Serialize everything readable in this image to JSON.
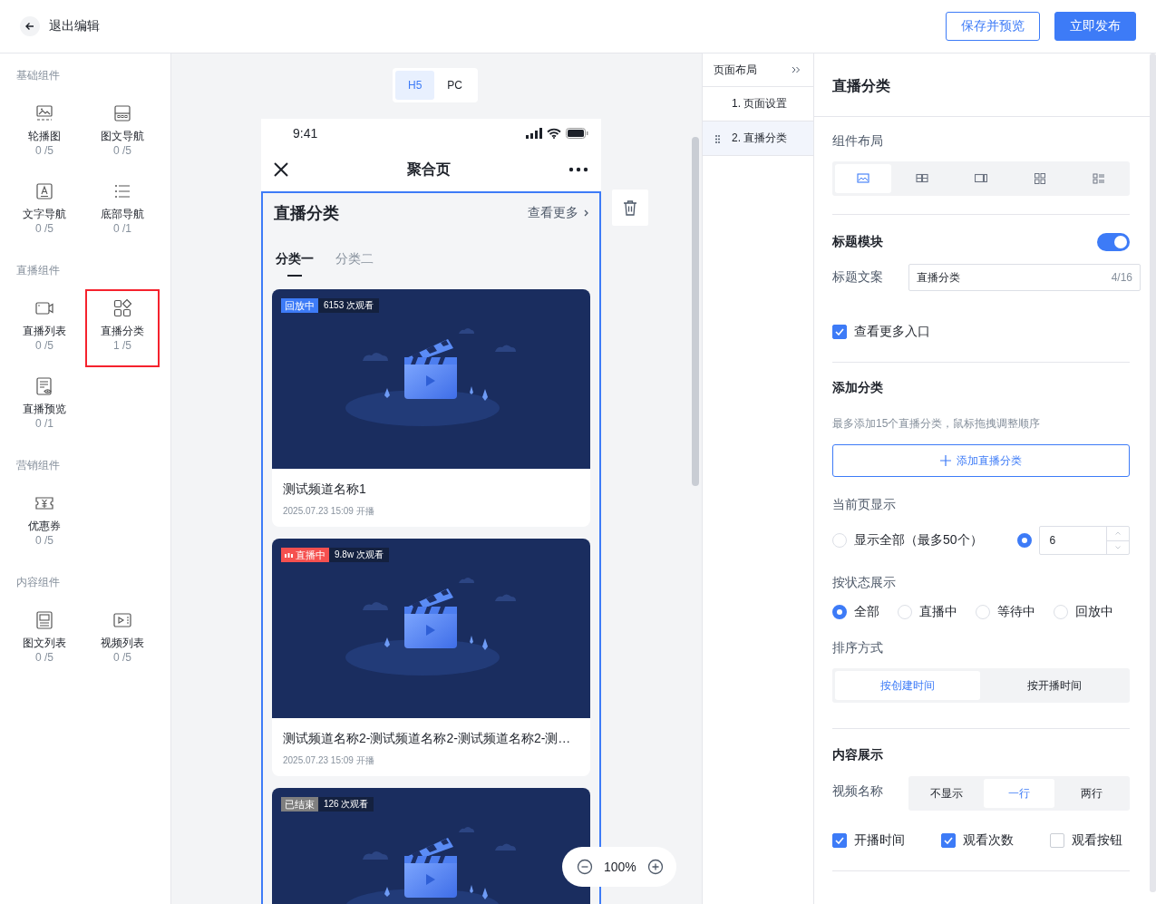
{
  "top_bar": {
    "back_label": "退出编辑",
    "buttons": [
      {
        "label": "保存并预览",
        "kind": "outline"
      },
      {
        "label": "立即发布",
        "kind": "primary"
      }
    ]
  },
  "palette": {
    "groups": [
      {
        "title": "基础组件",
        "items": [
          {
            "label": "轮播图",
            "count": "0 /5",
            "kind": "carousel",
            "selected": false
          },
          {
            "label": "图文导航",
            "count": "0 /5",
            "kind": "graphic-nav",
            "selected": false
          },
          {
            "label": "文字导航",
            "count": "0 /5",
            "kind": "text-nav",
            "selected": false
          },
          {
            "label": "底部导航",
            "count": "0 /1",
            "kind": "bottom-nav",
            "selected": false
          }
        ]
      },
      {
        "title": "直播组件",
        "items": [
          {
            "label": "直播列表",
            "count": "0 /5",
            "kind": "live-list",
            "selected": false
          },
          {
            "label": "直播分类",
            "count": "1 /5",
            "kind": "live-category",
            "selected": true
          },
          {
            "label": "直播预览",
            "count": "0 /1",
            "kind": "live-preview",
            "selected": false
          }
        ]
      },
      {
        "title": "营销组件",
        "items": [
          {
            "label": "优惠券",
            "count": "0 /5",
            "kind": "coupon",
            "selected": false
          }
        ]
      },
      {
        "title": "内容组件",
        "items": [
          {
            "label": "图文列表",
            "count": "0 /5",
            "kind": "graphic-list",
            "selected": false
          },
          {
            "label": "视频列表",
            "count": "0 /5",
            "kind": "video-list",
            "selected": false
          }
        ]
      }
    ]
  },
  "preview": {
    "device_tabs": [
      {
        "label": "H5",
        "selected": true
      },
      {
        "label": "PC",
        "selected": false
      }
    ],
    "status_time": "9:41",
    "page_title": "聚合页",
    "section": {
      "title": "直播分类",
      "more": "查看更多",
      "tabs": [
        {
          "label": "分类一",
          "selected": true
        },
        {
          "label": "分类二",
          "selected": false
        }
      ]
    },
    "cards": [
      {
        "status": "回放中",
        "kind": "replay",
        "views": "6153 次观看",
        "title": "测试频道名称1",
        "time": "2025.07.23 15:09 开播"
      },
      {
        "status": "直播中",
        "kind": "live",
        "views": "9.8w 次观看",
        "title": "测试频道名称2-测试频道名称2-测试频道名称2-测…",
        "time": "2025.07.23 15:09 开播"
      },
      {
        "status": "已结束",
        "kind": "ended",
        "views": "126 次观看"
      }
    ],
    "zoom": "100%"
  },
  "layers": {
    "title": "页面布局",
    "items": [
      {
        "label": "1. 页面设置",
        "selected": false
      },
      {
        "label": "2. 直播分类",
        "selected": true
      }
    ]
  },
  "settings": {
    "title": "直播分类",
    "layout_label": "组件布局",
    "layout_options": [
      {
        "kind": "single",
        "selected": true
      },
      {
        "kind": "double",
        "selected": false
      },
      {
        "kind": "side",
        "selected": false
      },
      {
        "kind": "grid",
        "selected": false
      },
      {
        "kind": "list",
        "selected": false
      }
    ],
    "title_module": {
      "label": "标题模块",
      "on": true
    },
    "title_text": {
      "label": "标题文案",
      "value": "直播分类",
      "counter": "4/16"
    },
    "more_entry": {
      "label": "查看更多入口",
      "checked": true
    },
    "add_category": {
      "heading": "添加分类",
      "hint": "最多添加15个直播分类，鼠标拖拽调整顺序",
      "button": "添加直播分类"
    },
    "per_page": {
      "label": "当前页显示",
      "options": [
        {
          "kind": "text",
          "label": "显示全部（最多50个）",
          "selected": false
        },
        {
          "kind": "number",
          "value": "6",
          "selected": true
        }
      ]
    },
    "status_filter": {
      "label": "按状态展示",
      "options": [
        {
          "label": "全部",
          "selected": true
        },
        {
          "label": "直播中",
          "selected": false
        },
        {
          "label": "等待中",
          "selected": false
        },
        {
          "label": "回放中",
          "selected": false
        }
      ]
    },
    "sort": {
      "label": "排序方式",
      "options": [
        {
          "label": "按创建时间",
          "selected": true
        },
        {
          "label": "按开播时间",
          "selected": false
        }
      ]
    },
    "content_heading": "内容展示",
    "video_name": {
      "label": "视频名称",
      "options": [
        {
          "label": "不显示",
          "selected": false
        },
        {
          "label": "一行",
          "selected": true
        },
        {
          "label": "两行",
          "selected": false
        }
      ]
    },
    "display_checks": [
      {
        "label": "开播时间",
        "checked": true
      },
      {
        "label": "观看次数",
        "checked": true
      },
      {
        "label": "观看按钮",
        "checked": false
      }
    ]
  }
}
